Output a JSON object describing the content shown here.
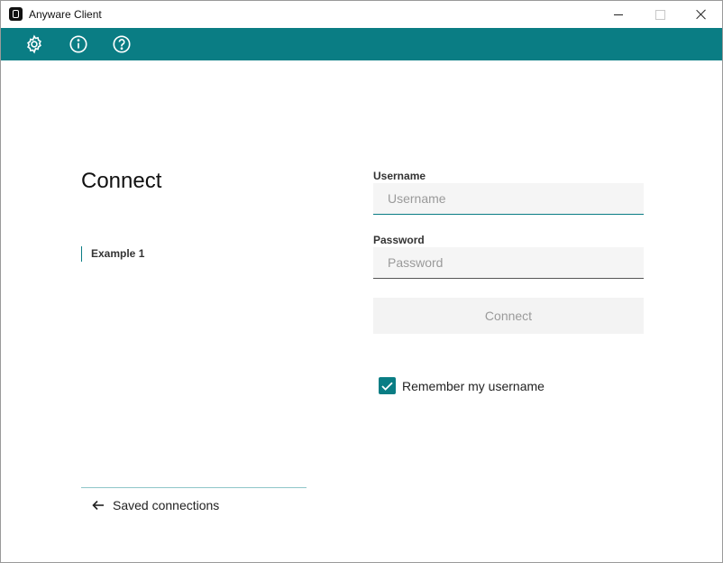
{
  "window": {
    "title": "Anyware Client",
    "accent_color": "#0a7d84"
  },
  "toolbar": {
    "icons": [
      "gear-icon",
      "info-icon",
      "help-icon"
    ]
  },
  "left": {
    "heading": "Connect",
    "connections": [
      {
        "label": "Example 1"
      }
    ],
    "saved_connections_label": "Saved connections"
  },
  "form": {
    "username_label": "Username",
    "username_placeholder": "Username",
    "username_value": "",
    "password_label": "Password",
    "password_placeholder": "Password",
    "password_value": "",
    "connect_label": "Connect",
    "remember_label": "Remember my username",
    "remember_checked": true
  }
}
